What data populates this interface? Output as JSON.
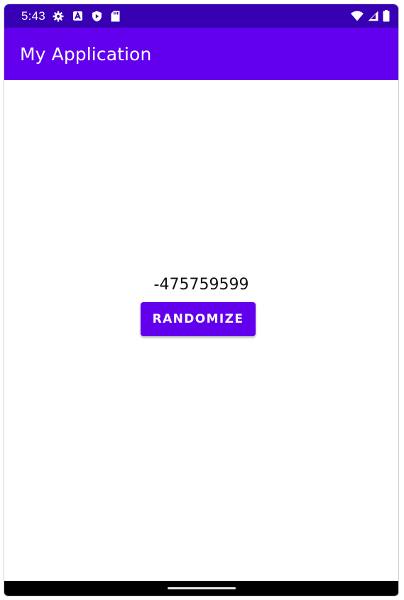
{
  "status_bar": {
    "time": "5:43",
    "icons_left": [
      "settings-gear-icon",
      "accessibility-a-icon",
      "play-protect-icon",
      "sd-card-icon"
    ],
    "icons_right": [
      "wifi-icon",
      "cell-signal-icon",
      "battery-icon"
    ]
  },
  "app_bar": {
    "title": "My Application"
  },
  "main": {
    "number": "-475759599",
    "randomize_label": "RANDOMIZE"
  },
  "colors": {
    "status_bar": "#3700b3",
    "primary": "#6200ee",
    "text": "#111111",
    "nav_bar": "#000000"
  }
}
